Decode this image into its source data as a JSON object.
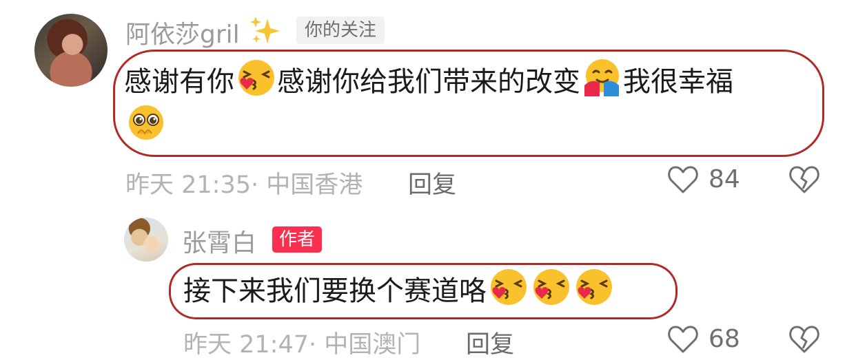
{
  "comments": [
    {
      "username": "阿依莎gril",
      "tag": "你的关注",
      "text_line1_a": "感谢有你",
      "text_line1_b": "感谢你给我们带来的改变",
      "text_line1_c": "我很幸福",
      "meta": "昨天 21:35· 中国香港",
      "reply": "回复",
      "likes": "84",
      "emojis": [
        "kissing-heart-emoji",
        "hugging-face-emoji",
        "pleading-face-emoji"
      ]
    },
    {
      "username": "张霄白",
      "tag": "作者",
      "text": "接下来我们要换个赛道咯",
      "meta": "昨天 21:47· 中国澳门",
      "reply": "回复",
      "likes": "68",
      "emojis": [
        "kissing-heart-emoji",
        "kissing-heart-emoji",
        "kissing-heart-emoji"
      ]
    }
  ],
  "colors": {
    "author_tag": "#fb2f4f",
    "highlight_outline": "#b02a27",
    "follow_tag_bg": "#f1f1f1"
  },
  "icons": [
    "sparkles-icon",
    "heart-icon",
    "broken-heart-icon"
  ]
}
